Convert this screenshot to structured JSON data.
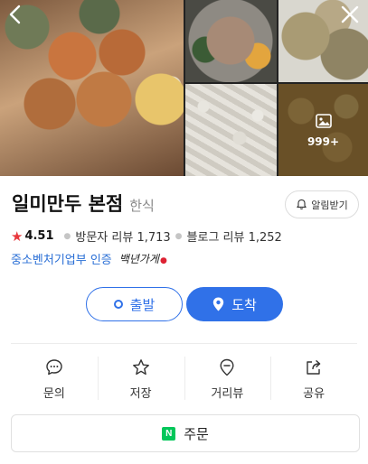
{
  "gallery": {
    "more_count": "999+",
    "icons": {
      "back": "chevron-left-icon",
      "close": "close-icon",
      "more": "image-icon"
    }
  },
  "place": {
    "name": "일미만두 본점",
    "category": "한식",
    "alarm_label": "알림받기",
    "rating": "4.51",
    "visitor_reviews": "방문자 리뷰 1,713",
    "blog_reviews": "블로그 리뷰 1,252",
    "certification": "중소벤처기업부 인증",
    "certification_logo_text": "백년가게"
  },
  "route": {
    "depart_label": "출발",
    "arrive_label": "도착"
  },
  "actions": [
    {
      "label": "문의",
      "icon": "chat-icon"
    },
    {
      "label": "저장",
      "icon": "star-icon"
    },
    {
      "label": "거리뷰",
      "icon": "street-view-pin-icon"
    },
    {
      "label": "공유",
      "icon": "share-icon"
    }
  ],
  "order": {
    "logo_text": "N",
    "label": "주문"
  },
  "colors": {
    "accent": "#3071e8",
    "star": "#e8383d",
    "naver_green": "#03c75a",
    "cert_link": "#2a6fd6"
  }
}
